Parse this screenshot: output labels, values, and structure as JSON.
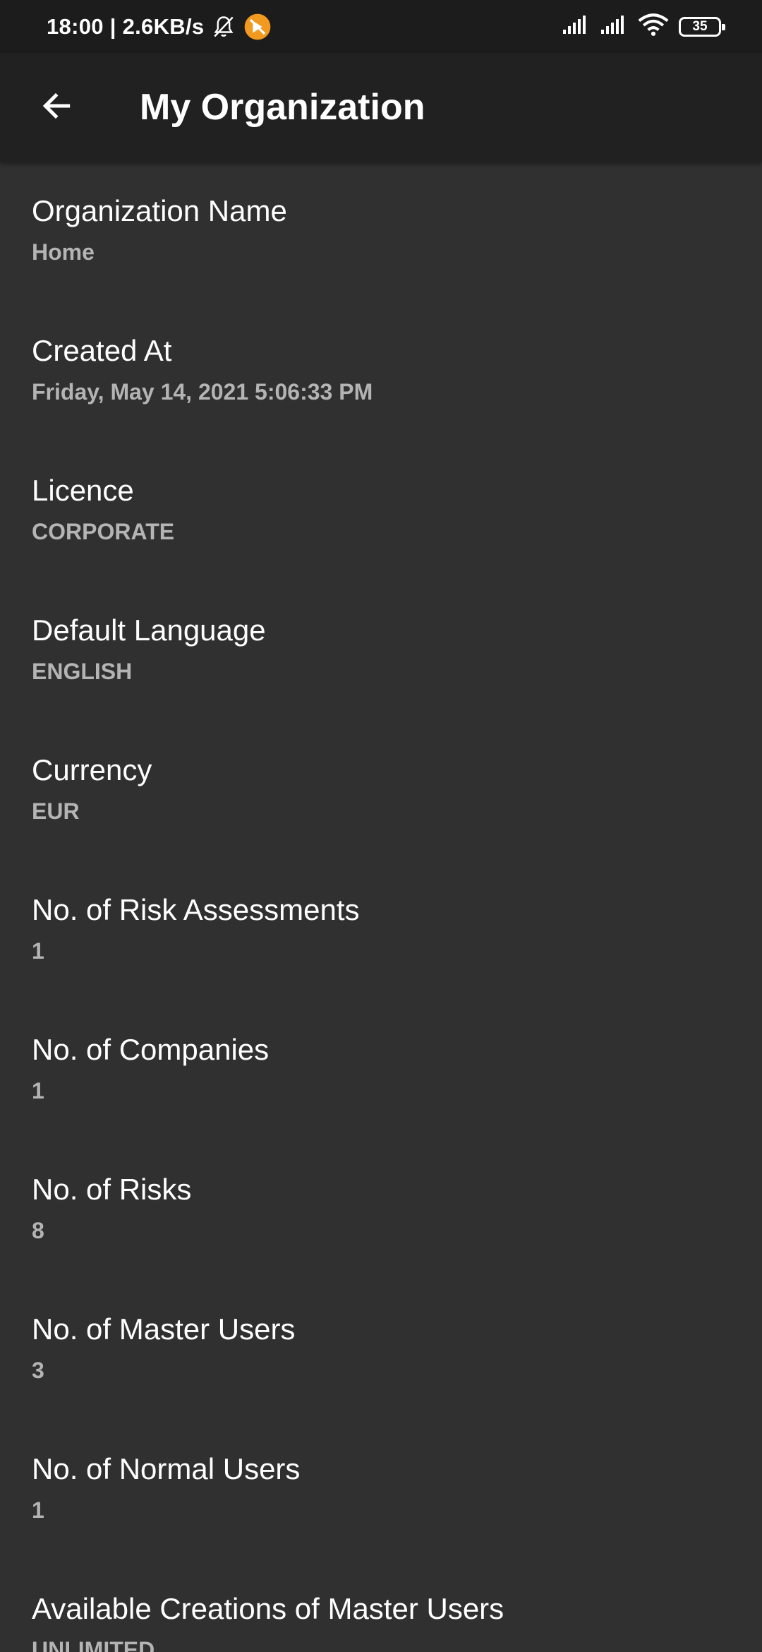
{
  "status_bar": {
    "time_speed": "18:00 | 2.6KB/s",
    "battery": "35",
    "icons": [
      "bell-off-icon",
      "app-notification-icon",
      "signal-icon",
      "signal-icon",
      "wifi-icon",
      "battery-icon"
    ],
    "accent_orange": "#f29a1f"
  },
  "app_bar": {
    "title": "My Organization",
    "back_icon": "arrow-left-icon"
  },
  "fields": [
    {
      "label": "Organization Name",
      "value": "Home"
    },
    {
      "label": "Created At",
      "value": "Friday, May 14, 2021 5:06:33 PM"
    },
    {
      "label": "Licence",
      "value": "CORPORATE"
    },
    {
      "label": "Default Language",
      "value": "ENGLISH"
    },
    {
      "label": "Currency",
      "value": "EUR"
    },
    {
      "label": "No. of Risk Assessments",
      "value": "1"
    },
    {
      "label": "No. of Companies",
      "value": "1"
    },
    {
      "label": "No. of Risks",
      "value": "8"
    },
    {
      "label": "No. of Master Users",
      "value": "3"
    },
    {
      "label": "No. of Normal Users",
      "value": "1"
    },
    {
      "label": "Available Creations of Master Users",
      "value": "UNLIMITED"
    }
  ],
  "colors": {
    "background": "#303030",
    "app_bar": "#212121",
    "status_bar": "#1c1c1c",
    "label": "#ffffff",
    "value": "#b4b4b4"
  }
}
